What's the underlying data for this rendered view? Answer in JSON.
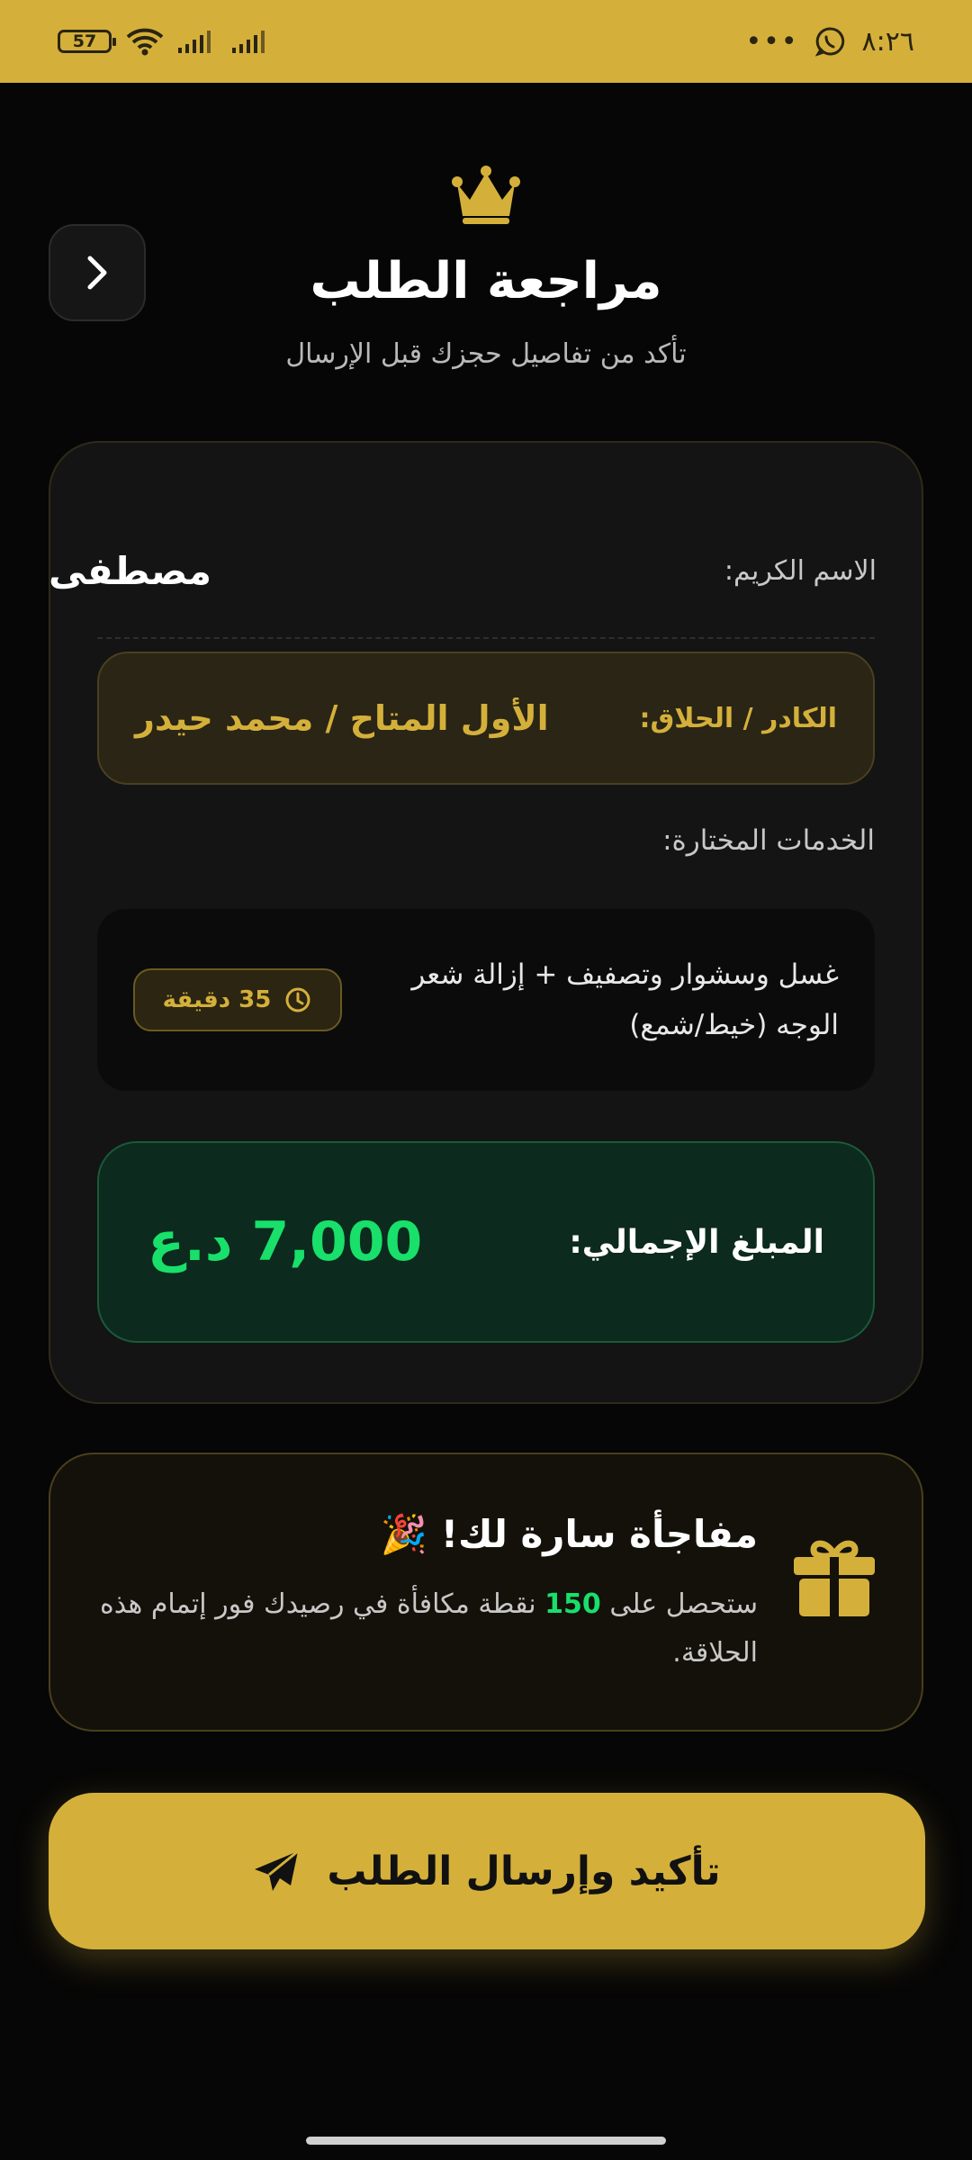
{
  "status_bar": {
    "battery": "57",
    "time": "٨:٢٦",
    "more_dots": "•••"
  },
  "header": {
    "title": "مراجعة الطلب",
    "subtitle": "تأكد من تفاصيل حجزك قبل الإرسال"
  },
  "summary": {
    "name_label": "الاسم الكريم:",
    "name_value": "مصطفى",
    "barber_label": "الكادر / الحلاق:",
    "barber_value": "الأول المتاح / محمد حيدر",
    "services_label": "الخدمات المختارة:",
    "services": [
      {
        "name": "غسل وسشوار وتصفيف + إزالة شعر الوجه (خيط/شمع)",
        "duration": "35 دقيقة"
      }
    ],
    "total_label": "المبلغ الإجمالي:",
    "total_value": "7,000 د.ع"
  },
  "reward": {
    "title": "مفاجأة سارة لك! 🎉",
    "text_before": "ستحصل على",
    "points": "150",
    "text_after": "نقطة مكافأة في رصيدك فور إتمام هذه الحلاقة."
  },
  "confirm_button": {
    "label": "تأكيد وإرسال الطلب"
  },
  "icons": {
    "crown": "crown-icon",
    "back": "chevron-right-icon",
    "clock": "clock-icon",
    "gift": "gift-icon",
    "send": "paper-plane-icon",
    "wifi": "wifi-icon",
    "signal": "signal-icon",
    "whatsapp": "whatsapp-icon"
  },
  "colors": {
    "accent_gold": "#d4b03b",
    "accent_green": "#18e06a",
    "background": "#060606",
    "card": "#141414"
  }
}
